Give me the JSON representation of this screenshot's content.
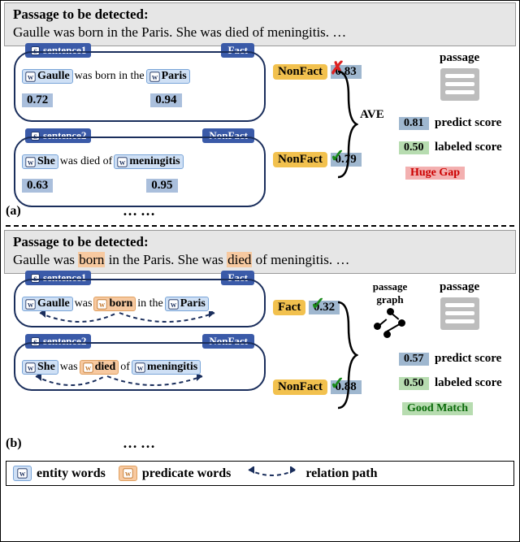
{
  "passage_title": "Passage to be detected:",
  "passage_text_a": "Gaulle was born in the Paris. She was died of meningitis. …",
  "passage_text_b_pre": "Gaulle was ",
  "passage_text_b_w1": "born",
  "passage_text_b_mid1": " in the Paris. She was ",
  "passage_text_b_w2": "died",
  "passage_text_b_post": " of meningitis. …",
  "sentences": {
    "a": {
      "s1": {
        "tag": "sentence1",
        "fact": "Fact",
        "w1": "Gaulle",
        "t1": "was born in the",
        "w2": "Paris",
        "sc1": "0.72",
        "sc2": "0.94",
        "pred": "NonFact",
        "score": "0.83",
        "correct": false
      },
      "s2": {
        "tag": "sentence2",
        "fact": "NonFact",
        "w1": "She",
        "t1": "was died of",
        "w2": "meningitis",
        "sc1": "0.63",
        "sc2": "0.95",
        "pred": "NonFact",
        "score": "0.79",
        "correct": true
      }
    },
    "b": {
      "s1": {
        "tag": "sentence1",
        "fact": "Fact",
        "w1": "Gaulle",
        "t1": "was",
        "p1": "born",
        "t2": "in the",
        "w2": "Paris",
        "pred": "Fact",
        "score": "0.32",
        "correct": true
      },
      "s2": {
        "tag": "sentence2",
        "fact": "NonFact",
        "w1": "She",
        "t1": "was",
        "p1": "died",
        "t2": "of",
        "w2": "meningitis",
        "pred": "NonFact",
        "score": "0.88",
        "correct": true
      }
    }
  },
  "right_a": {
    "ave": "AVE",
    "passage_label": "passage",
    "predict": "0.81",
    "predict_label": "predict score",
    "labeled": "0.50",
    "labeled_label": "labeled score",
    "gap": "Huge Gap"
  },
  "right_b": {
    "passage_graph": "passage\ngraph",
    "passage_label": "passage",
    "predict": "0.57",
    "predict_label": "predict score",
    "labeled": "0.50",
    "labeled_label": "labeled score",
    "good": "Good Match"
  },
  "section_a": "(a)",
  "section_b": "(b)",
  "legend": {
    "entity": "entity words",
    "predicate": "predicate words",
    "relation": "relation path"
  },
  "chart_data": {
    "type": "diagram",
    "panels": [
      {
        "id": "a",
        "passage": "Gaulle was born in the Paris. She was died of meningitis. …",
        "sentences": [
          {
            "id": "sentence1",
            "true_label": "Fact",
            "pred_label": "NonFact",
            "pred_score": 0.83,
            "correct": false,
            "entities": [
              {
                "text": "Gaulle",
                "score": 0.72
              },
              {
                "text": "Paris",
                "score": 0.94
              }
            ]
          },
          {
            "id": "sentence2",
            "true_label": "NonFact",
            "pred_label": "NonFact",
            "pred_score": 0.79,
            "correct": true,
            "entities": [
              {
                "text": "She",
                "score": 0.63
              },
              {
                "text": "meningitis",
                "score": 0.95
              }
            ]
          }
        ],
        "aggregate": {
          "method": "AVE",
          "predict_score": 0.81,
          "labeled_score": 0.5,
          "verdict": "Huge Gap"
        }
      },
      {
        "id": "b",
        "passage": "Gaulle was born in the Paris. She was died of meningitis. …",
        "highlighted_predicates": [
          "born",
          "died"
        ],
        "sentences": [
          {
            "id": "sentence1",
            "true_label": "Fact",
            "pred_label": "Fact",
            "pred_score": 0.32,
            "correct": true,
            "entities": [
              "Gaulle",
              "Paris"
            ],
            "predicates": [
              "born"
            ],
            "relation_path": true
          },
          {
            "id": "sentence2",
            "true_label": "NonFact",
            "pred_label": "NonFact",
            "pred_score": 0.88,
            "correct": true,
            "entities": [
              "She",
              "meningitis"
            ],
            "predicates": [
              "died"
            ],
            "relation_path": true
          }
        ],
        "aggregate": {
          "uses": "passage graph",
          "predict_score": 0.57,
          "labeled_score": 0.5,
          "verdict": "Good Match"
        }
      }
    ]
  }
}
